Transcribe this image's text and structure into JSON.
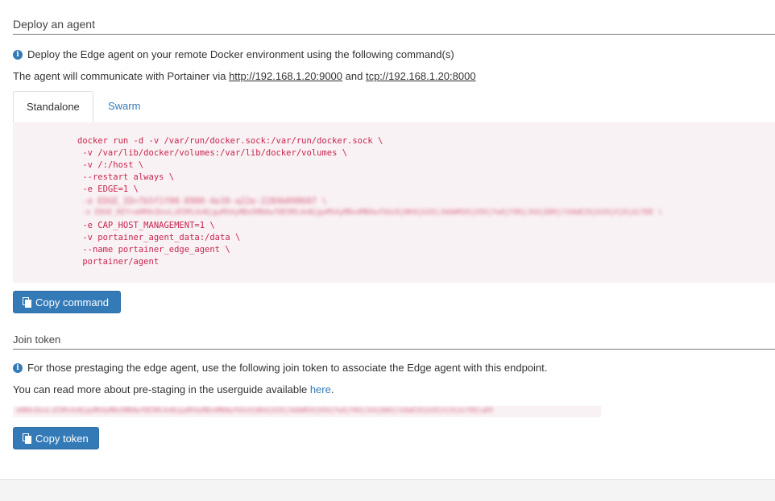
{
  "deploy": {
    "title": "Deploy an agent",
    "info_text": "Deploy the Edge agent on your remote Docker environment using the following command(s)",
    "comm_prefix": "The agent will communicate with Portainer via ",
    "http_url": "http://192.168.1.20:9000",
    "and_text": " and ",
    "tcp_url": "tcp://192.168.1.20:8000"
  },
  "tabs": [
    "Standalone",
    "Swarm"
  ],
  "command_lines": [
    "docker run -d -v /var/run/docker.sock:/var/run/docker.sock \\",
    " -v /var/lib/docker/volumes:/var/lib/docker/volumes \\",
    " -v /:/host \\",
    " --restart always \\",
    " -e EDGE=1 \\",
    " -e EDGE_ID=7b5f1f00-8980-4e39-a22e-2284b098687 \\",
    " -e EDGE_KEY=aHR0cDovLzE5Mi4xNjguMS4yMDo5MDAwfDE5Mi4xNjguMS4yMDo4MDAwfGUzOjNhOjU2OjJmOmM2OjU5OjYwOjY0OjJkOjQ0OjlhOmE2OjU2OjVjOjdifDE \\",
    " -e CAP_HOST_MANAGEMENT=1 \\",
    " -v portainer_agent_data:/data \\",
    " --name portainer_edge_agent \\",
    " portainer/agent"
  ],
  "copy_command_label": "Copy command",
  "join": {
    "title": "Join token",
    "info_text": "For those prestaging the edge agent, use the following join token to associate the Edge agent with this endpoint.",
    "read_more_prefix": "You can read more about pre-staging in the userguide available ",
    "here_link": "here",
    "read_more_suffix": ".",
    "token": "aHR0cDovLzE5Mi4xNjguMS4yMDo5MDAwfDE5Mi4xNjguMS4yMDo4MDAwfGUzOjNhOjU2OjJmOmM2OjU5OjYwOjY0OjJkOjQ0OjlhOmE2OjU2OjVjOjdifDEjqPE",
    "copy_token_label": "Copy token"
  },
  "colors": {
    "accent": "#337ab7",
    "code_bg": "#f9f2f4",
    "code_text": "#c7254e"
  },
  "icons": {
    "info": "info-circle-icon",
    "copy": "copy-icon"
  }
}
